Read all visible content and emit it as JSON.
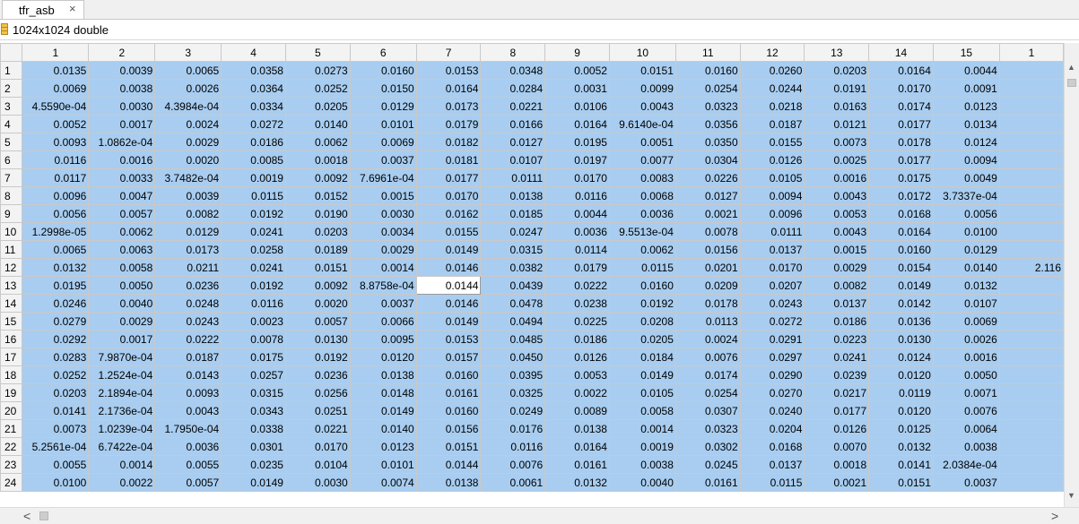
{
  "tab": {
    "label": "tfr_asb",
    "close_glyph": "×"
  },
  "info": {
    "size_label": "1024x1024 double",
    "icon": "matrix-variable-icon"
  },
  "grid": {
    "column_headers": [
      "1",
      "2",
      "3",
      "4",
      "5",
      "6",
      "7",
      "8",
      "9",
      "10",
      "11",
      "12",
      "13",
      "14",
      "15",
      "1"
    ],
    "row_headers": [
      "1",
      "2",
      "3",
      "4",
      "5",
      "6",
      "7",
      "8",
      "9",
      "10",
      "11",
      "12",
      "13",
      "14",
      "15",
      "16",
      "17",
      "18",
      "19",
      "20",
      "21",
      "22",
      "23",
      "24"
    ],
    "selected_cell": {
      "row": "13",
      "column": "7",
      "value": "0.0144"
    },
    "rows": [
      [
        "0.0135",
        "0.0039",
        "0.0065",
        "0.0358",
        "0.0273",
        "0.0160",
        "0.0153",
        "0.0348",
        "0.0052",
        "0.0151",
        "0.0160",
        "0.0260",
        "0.0203",
        "0.0164",
        "0.0044",
        ""
      ],
      [
        "0.0069",
        "0.0038",
        "0.0026",
        "0.0364",
        "0.0252",
        "0.0150",
        "0.0164",
        "0.0284",
        "0.0031",
        "0.0099",
        "0.0254",
        "0.0244",
        "0.0191",
        "0.0170",
        "0.0091",
        ""
      ],
      [
        "4.5590e-04",
        "0.0030",
        "4.3984e-04",
        "0.0334",
        "0.0205",
        "0.0129",
        "0.0173",
        "0.0221",
        "0.0106",
        "0.0043",
        "0.0323",
        "0.0218",
        "0.0163",
        "0.0174",
        "0.0123",
        ""
      ],
      [
        "0.0052",
        "0.0017",
        "0.0024",
        "0.0272",
        "0.0140",
        "0.0101",
        "0.0179",
        "0.0166",
        "0.0164",
        "9.6140e-04",
        "0.0356",
        "0.0187",
        "0.0121",
        "0.0177",
        "0.0134",
        ""
      ],
      [
        "0.0093",
        "1.0862e-04",
        "0.0029",
        "0.0186",
        "0.0062",
        "0.0069",
        "0.0182",
        "0.0127",
        "0.0195",
        "0.0051",
        "0.0350",
        "0.0155",
        "0.0073",
        "0.0178",
        "0.0124",
        ""
      ],
      [
        "0.0116",
        "0.0016",
        "0.0020",
        "0.0085",
        "0.0018",
        "0.0037",
        "0.0181",
        "0.0107",
        "0.0197",
        "0.0077",
        "0.0304",
        "0.0126",
        "0.0025",
        "0.0177",
        "0.0094",
        ""
      ],
      [
        "0.0117",
        "0.0033",
        "3.7482e-04",
        "0.0019",
        "0.0092",
        "7.6961e-04",
        "0.0177",
        "0.0111",
        "0.0170",
        "0.0083",
        "0.0226",
        "0.0105",
        "0.0016",
        "0.0175",
        "0.0049",
        ""
      ],
      [
        "0.0096",
        "0.0047",
        "0.0039",
        "0.0115",
        "0.0152",
        "0.0015",
        "0.0170",
        "0.0138",
        "0.0116",
        "0.0068",
        "0.0127",
        "0.0094",
        "0.0043",
        "0.0172",
        "3.7337e-04",
        ""
      ],
      [
        "0.0056",
        "0.0057",
        "0.0082",
        "0.0192",
        "0.0190",
        "0.0030",
        "0.0162",
        "0.0185",
        "0.0044",
        "0.0036",
        "0.0021",
        "0.0096",
        "0.0053",
        "0.0168",
        "0.0056",
        ""
      ],
      [
        "1.2998e-05",
        "0.0062",
        "0.0129",
        "0.0241",
        "0.0203",
        "0.0034",
        "0.0155",
        "0.0247",
        "0.0036",
        "9.5513e-04",
        "0.0078",
        "0.0111",
        "0.0043",
        "0.0164",
        "0.0100",
        ""
      ],
      [
        "0.0065",
        "0.0063",
        "0.0173",
        "0.0258",
        "0.0189",
        "0.0029",
        "0.0149",
        "0.0315",
        "0.0114",
        "0.0062",
        "0.0156",
        "0.0137",
        "0.0015",
        "0.0160",
        "0.0129",
        ""
      ],
      [
        "0.0132",
        "0.0058",
        "0.0211",
        "0.0241",
        "0.0151",
        "0.0014",
        "0.0146",
        "0.0382",
        "0.0179",
        "0.0115",
        "0.0201",
        "0.0170",
        "0.0029",
        "0.0154",
        "0.0140",
        "2.116"
      ],
      [
        "0.0195",
        "0.0050",
        "0.0236",
        "0.0192",
        "0.0092",
        "8.8758e-04",
        "0.0144",
        "0.0439",
        "0.0222",
        "0.0160",
        "0.0209",
        "0.0207",
        "0.0082",
        "0.0149",
        "0.0132",
        ""
      ],
      [
        "0.0246",
        "0.0040",
        "0.0248",
        "0.0116",
        "0.0020",
        "0.0037",
        "0.0146",
        "0.0478",
        "0.0238",
        "0.0192",
        "0.0178",
        "0.0243",
        "0.0137",
        "0.0142",
        "0.0107",
        ""
      ],
      [
        "0.0279",
        "0.0029",
        "0.0243",
        "0.0023",
        "0.0057",
        "0.0066",
        "0.0149",
        "0.0494",
        "0.0225",
        "0.0208",
        "0.0113",
        "0.0272",
        "0.0186",
        "0.0136",
        "0.0069",
        ""
      ],
      [
        "0.0292",
        "0.0017",
        "0.0222",
        "0.0078",
        "0.0130",
        "0.0095",
        "0.0153",
        "0.0485",
        "0.0186",
        "0.0205",
        "0.0024",
        "0.0291",
        "0.0223",
        "0.0130",
        "0.0026",
        ""
      ],
      [
        "0.0283",
        "7.9870e-04",
        "0.0187",
        "0.0175",
        "0.0192",
        "0.0120",
        "0.0157",
        "0.0450",
        "0.0126",
        "0.0184",
        "0.0076",
        "0.0297",
        "0.0241",
        "0.0124",
        "0.0016",
        ""
      ],
      [
        "0.0252",
        "1.2524e-04",
        "0.0143",
        "0.0257",
        "0.0236",
        "0.0138",
        "0.0160",
        "0.0395",
        "0.0053",
        "0.0149",
        "0.0174",
        "0.0290",
        "0.0239",
        "0.0120",
        "0.0050",
        ""
      ],
      [
        "0.0203",
        "2.1894e-04",
        "0.0093",
        "0.0315",
        "0.0256",
        "0.0148",
        "0.0161",
        "0.0325",
        "0.0022",
        "0.0105",
        "0.0254",
        "0.0270",
        "0.0217",
        "0.0119",
        "0.0071",
        ""
      ],
      [
        "0.0141",
        "2.1736e-04",
        "0.0043",
        "0.0343",
        "0.0251",
        "0.0149",
        "0.0160",
        "0.0249",
        "0.0089",
        "0.0058",
        "0.0307",
        "0.0240",
        "0.0177",
        "0.0120",
        "0.0076",
        ""
      ],
      [
        "0.0073",
        "1.0239e-04",
        "1.7950e-04",
        "0.0338",
        "0.0221",
        "0.0140",
        "0.0156",
        "0.0176",
        "0.0138",
        "0.0014",
        "0.0323",
        "0.0204",
        "0.0126",
        "0.0125",
        "0.0064",
        ""
      ],
      [
        "5.2561e-04",
        "6.7422e-04",
        "0.0036",
        "0.0301",
        "0.0170",
        "0.0123",
        "0.0151",
        "0.0116",
        "0.0164",
        "0.0019",
        "0.0302",
        "0.0168",
        "0.0070",
        "0.0132",
        "0.0038",
        ""
      ],
      [
        "0.0055",
        "0.0014",
        "0.0055",
        "0.0235",
        "0.0104",
        "0.0101",
        "0.0144",
        "0.0076",
        "0.0161",
        "0.0038",
        "0.0245",
        "0.0137",
        "0.0018",
        "0.0141",
        "2.0384e-04",
        ""
      ],
      [
        "0.0100",
        "0.0022",
        "0.0057",
        "0.0149",
        "0.0030",
        "0.0074",
        "0.0138",
        "0.0061",
        "0.0132",
        "0.0040",
        "0.0161",
        "0.0115",
        "0.0021",
        "0.0151",
        "0.0037",
        ""
      ]
    ]
  },
  "scrollbars": {
    "up_arrow": "▲",
    "down_arrow": "▼",
    "left_arrow": "<",
    "right_arrow": ">"
  }
}
